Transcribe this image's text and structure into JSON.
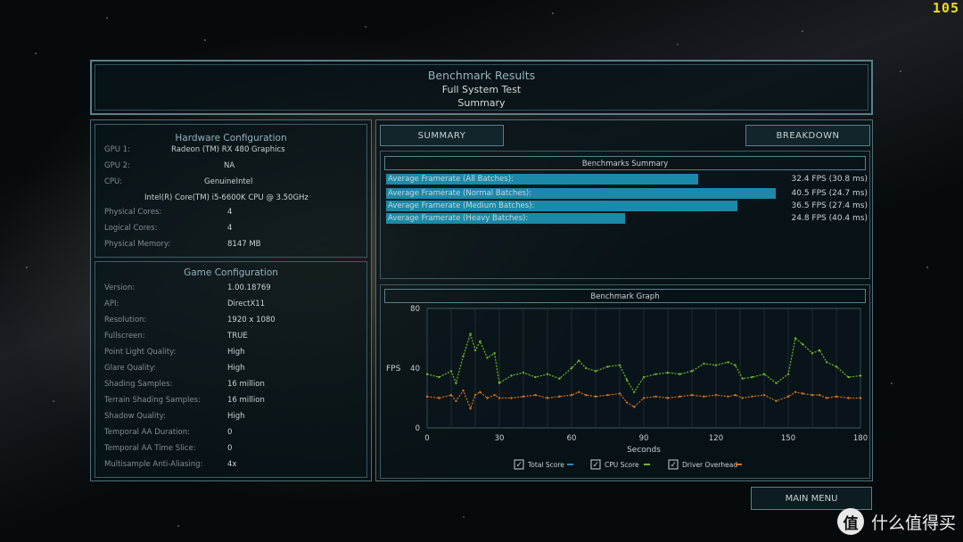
{
  "overlay": {
    "fps_counter": "105"
  },
  "header": {
    "title": "Benchmark Results",
    "subtitle": "Full System Test",
    "mode": "Summary"
  },
  "hardware": {
    "title": "Hardware Configuration",
    "rows": [
      {
        "label": "GPU 1:",
        "value": "Radeon (TM) RX 480 Graphics"
      },
      {
        "label": "GPU 2:",
        "value": "NA"
      },
      {
        "label": "CPU:",
        "value": "GenuineIntel"
      },
      {
        "label": "",
        "value": "Intel(R) Core(TM) i5-6600K CPU @ 3.50GHz"
      },
      {
        "label": "Physical Cores:",
        "value": "4"
      },
      {
        "label": "Logical Cores:",
        "value": "4"
      },
      {
        "label": "Physical Memory:",
        "value": "8147 MB"
      }
    ]
  },
  "game": {
    "title": "Game Configuration",
    "rows": [
      {
        "label": "Version:",
        "value": "1.00.18769"
      },
      {
        "label": "API:",
        "value": "DirectX11"
      },
      {
        "label": "Resolution:",
        "value": "1920 x 1080"
      },
      {
        "label": "Fullscreen:",
        "value": "TRUE"
      },
      {
        "label": "Point Light Quality:",
        "value": "High"
      },
      {
        "label": "Glare Quality:",
        "value": "High"
      },
      {
        "label": "Shading Samples:",
        "value": "16 million"
      },
      {
        "label": "Terrain Shading Samples:",
        "value": "16 million"
      },
      {
        "label": "Shadow Quality:",
        "value": "High"
      },
      {
        "label": "Temporal AA Duration:",
        "value": "0"
      },
      {
        "label": "Temporal AA Time Slice:",
        "value": "0"
      },
      {
        "label": "Multisample Anti-Aliasing:",
        "value": "4x"
      }
    ]
  },
  "tabs": {
    "summary": "SUMMARY",
    "breakdown": "BREAKDOWN"
  },
  "summary": {
    "title": "Benchmarks Summary",
    "scale_max_fps": 50,
    "items": [
      {
        "label": "Average Framerate (All Batches):",
        "fps": 32.4,
        "value": "32.4 FPS (30.8 ms)"
      },
      {
        "label": "Average Framerate (Normal Batches):",
        "fps": 40.5,
        "value": "40.5 FPS (24.7 ms)"
      },
      {
        "label": "Average Framerate (Medium Batches):",
        "fps": 36.5,
        "value": "36.5 FPS (27.4 ms)"
      },
      {
        "label": "Average Framerate (Heavy Batches):",
        "fps": 24.8,
        "value": "24.8 FPS (40.4 ms)"
      }
    ]
  },
  "graph": {
    "title": "Benchmark Graph"
  },
  "chart_data": {
    "type": "line",
    "ylabel": "FPS",
    "xlabel": "Seconds",
    "xlim": [
      0,
      180
    ],
    "ylim": [
      0,
      80
    ],
    "x_ticks": [
      "0",
      "30",
      "60",
      "90",
      "120",
      "150",
      "180"
    ],
    "y_ticks": [
      "0",
      "40",
      "80"
    ],
    "legend": [
      {
        "name": "Total Score",
        "checked": true,
        "color": "#2a8bc0"
      },
      {
        "name": "CPU Score",
        "checked": true,
        "color": "#6fb82a"
      },
      {
        "name": "Driver Overhead",
        "checked": true,
        "color": "#d9731e"
      }
    ],
    "series": [
      {
        "name": "CPU Score",
        "color": "#6fb82a",
        "x": [
          0,
          5,
          10,
          12,
          15,
          18,
          20,
          22,
          25,
          28,
          30,
          35,
          40,
          45,
          50,
          55,
          60,
          63,
          66,
          70,
          75,
          80,
          83,
          86,
          90,
          95,
          100,
          105,
          110,
          115,
          120,
          125,
          128,
          131,
          135,
          140,
          145,
          150,
          153,
          156,
          160,
          163,
          166,
          170,
          175,
          180
        ],
        "y": [
          36,
          34,
          38,
          30,
          48,
          63,
          52,
          58,
          47,
          50,
          30,
          35,
          37,
          34,
          36,
          33,
          40,
          45,
          40,
          38,
          41,
          42,
          32,
          24,
          34,
          36,
          37,
          36,
          38,
          43,
          42,
          44,
          42,
          33,
          34,
          36,
          30,
          36,
          60,
          56,
          50,
          52,
          44,
          41,
          34,
          35
        ]
      },
      {
        "name": "Driver Overhead",
        "color": "#d9731e",
        "x": [
          0,
          5,
          10,
          12,
          15,
          18,
          20,
          22,
          25,
          28,
          30,
          35,
          40,
          45,
          50,
          55,
          60,
          63,
          66,
          70,
          75,
          80,
          83,
          86,
          90,
          95,
          100,
          105,
          110,
          115,
          120,
          125,
          128,
          131,
          135,
          140,
          145,
          150,
          153,
          156,
          160,
          163,
          166,
          170,
          175,
          180
        ],
        "y": [
          21,
          20,
          22,
          18,
          25,
          13,
          22,
          24,
          20,
          22,
          20,
          20,
          21,
          22,
          20,
          21,
          22,
          24,
          22,
          21,
          22,
          23,
          17,
          14,
          20,
          21,
          20,
          21,
          22,
          21,
          22,
          21,
          22,
          20,
          21,
          22,
          18,
          21,
          24,
          23,
          22,
          22,
          20,
          21,
          20,
          20
        ]
      }
    ]
  },
  "main_menu_label": "MAIN MENU",
  "watermark": {
    "icon_text": "值",
    "text": "什么值得买"
  }
}
